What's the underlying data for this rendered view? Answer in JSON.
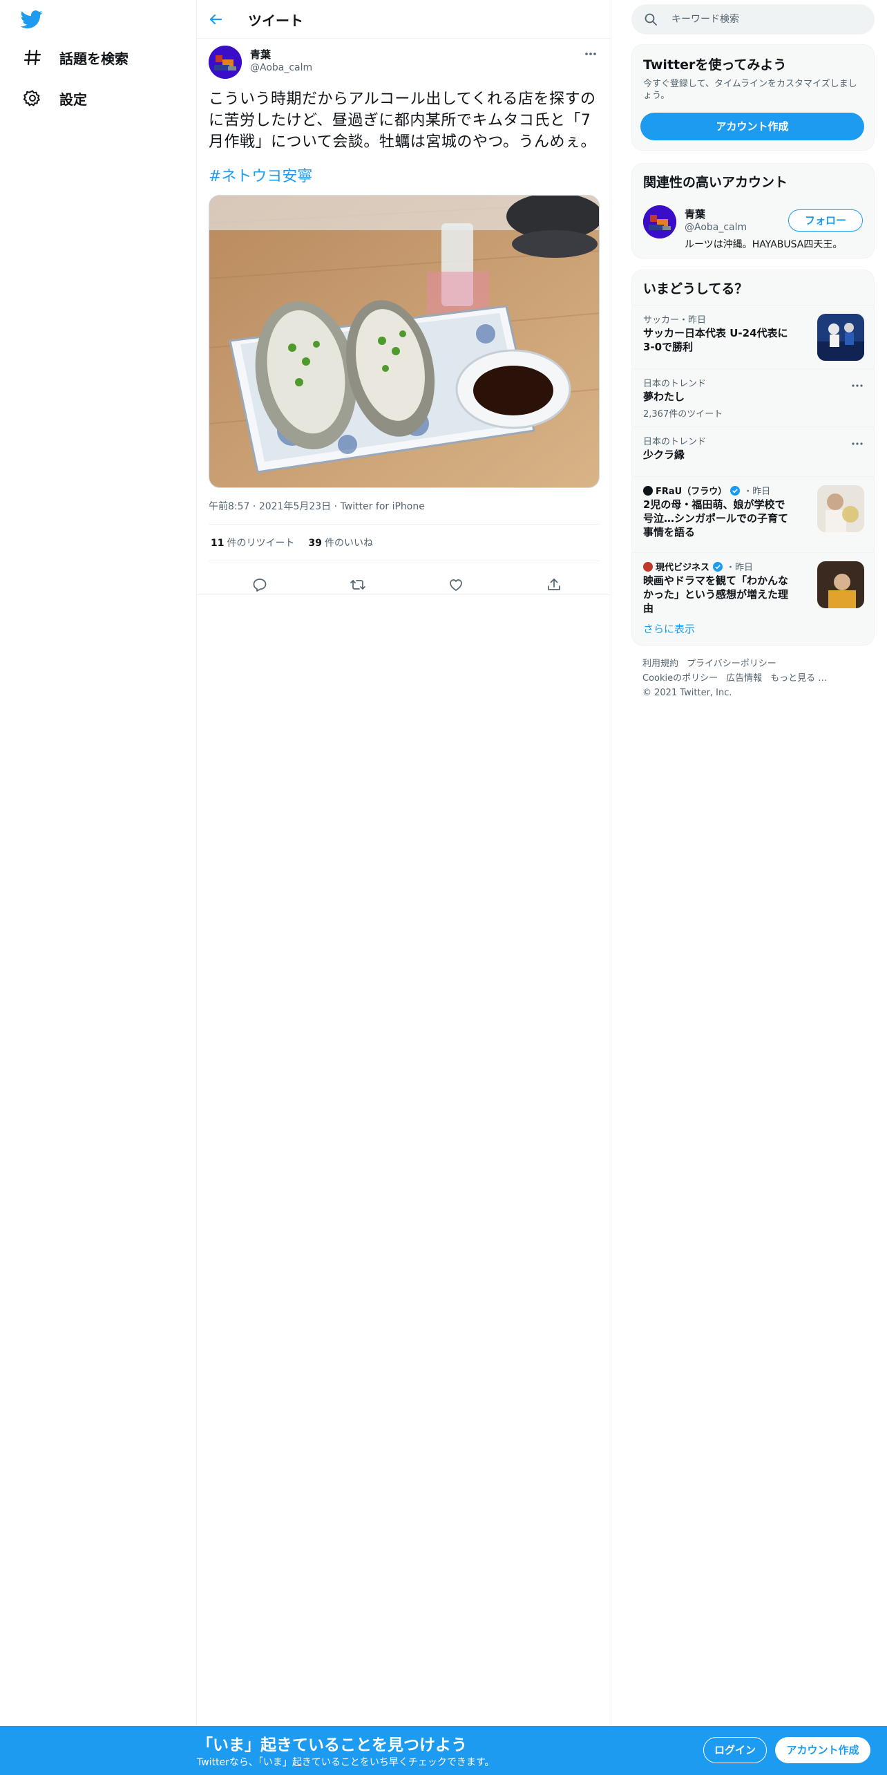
{
  "nav": {
    "explore_label": "話題を検索",
    "settings_label": "設定"
  },
  "header": {
    "title": "ツイート"
  },
  "tweet": {
    "author_name": "青葉",
    "author_handle": "@Aoba_calm",
    "text": "こういう時期だからアルコール出してくれる店を探すのに苦労したけど、昼過ぎに都内某所でキムタコ氏と「7月作戦」について会談。牡蠣は宮城のやつ。うんめぇ。",
    "hashtag": "#ネトウヨ安寧",
    "time": "午前8:57",
    "date": "2021年5月23日",
    "source": "Twitter for iPhone",
    "retweet_count": "11",
    "retweet_label": "件のリツイート",
    "like_count": "39",
    "like_label": "件のいいね"
  },
  "search": {
    "placeholder": "キーワード検索"
  },
  "join_card": {
    "title": "Twitterを使ってみよう",
    "subtitle": "今すぐ登録して、タイムラインをカスタマイズしましょう。",
    "button_label": "アカウント作成"
  },
  "related": {
    "title": "関連性の高いアカウント",
    "name": "青葉",
    "handle": "@Aoba_calm",
    "bio": "ルーツは沖縄。HAYABUSA四天王。",
    "follow_label": "フォロー"
  },
  "trends": {
    "title": "いまどうしてる？",
    "items": [
      {
        "context": "サッカー・昨日",
        "title": "サッカー日本代表 U-24代表に3-0で勝利"
      },
      {
        "context": "日本のトレンド",
        "title": "夢わたし",
        "count": "2,367件のツイート"
      },
      {
        "context": "日本のトレンド",
        "title": "少クラ縁"
      },
      {
        "source": "FRaU（フラウ）",
        "when": "・昨日",
        "title": "2児の母・福田萌、娘が学校で号泣…シンガポールでの子育て事情を語る"
      },
      {
        "source": "現代ビジネス",
        "when": "・昨日",
        "title": "映画やドラマを観て「わかんなかった」という感想が増えた理由"
      }
    ],
    "show_more": "さらに表示"
  },
  "footer": {
    "links": [
      "利用規約",
      "プライバシーポリシー",
      "Cookieのポリシー",
      "広告情報",
      "もっと見る …"
    ],
    "copyright": "© 2021 Twitter, Inc."
  },
  "banner": {
    "title": "「いま」起きていることを見つけよう",
    "subtitle": "Twitterなら、「いま」起きていることをいち早くチェックできます。",
    "login_label": "ログイン",
    "signup_label": "アカウント作成"
  },
  "colors": {
    "accent": "#1d9bf0",
    "text": "#0f1419",
    "secondary": "#536471",
    "avatar": "#3a0dc9"
  }
}
